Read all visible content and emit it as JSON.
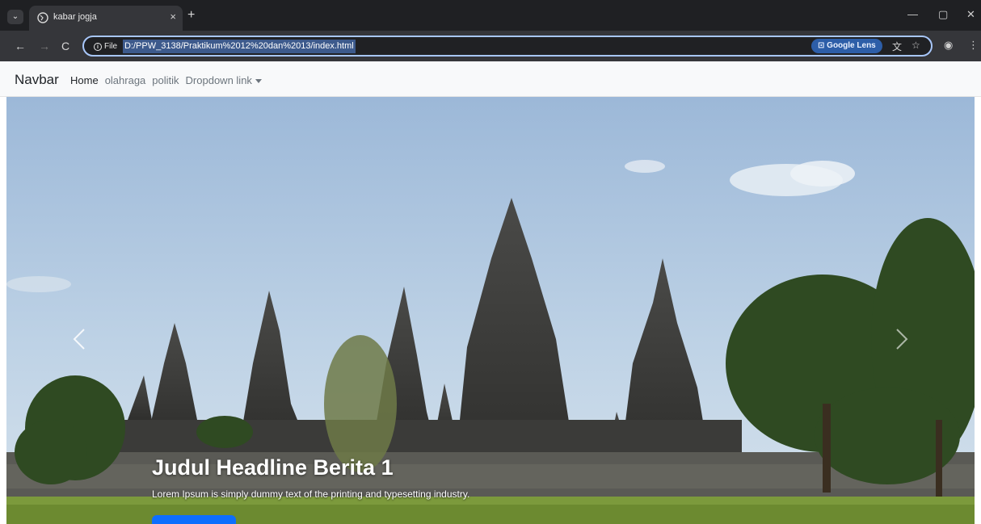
{
  "browser": {
    "tab": {
      "title": "kabar jogja",
      "close": "×"
    },
    "new_tab": "+",
    "window_controls": {
      "minimize": "—",
      "restore": "▢",
      "close": "✕"
    },
    "nav": {
      "back": "←",
      "forward": "→",
      "reload": "C"
    },
    "site_info_label": "File",
    "url": "D:/PPW_3138/Praktikum%2012%20dan%2013/index.html",
    "lens_label": "Google Lens",
    "icons": {
      "translate": "translate-icon",
      "bookmark": "star-icon",
      "profile": "profile-icon",
      "menu": "kebab-menu-icon"
    }
  },
  "navbar": {
    "brand": "Navbar",
    "links": [
      {
        "label": "Home",
        "active": true
      },
      {
        "label": "olahraga",
        "active": false
      },
      {
        "label": "politik",
        "active": false
      },
      {
        "label": "Dropdown link",
        "active": false,
        "dropdown": true
      }
    ]
  },
  "carousel": {
    "caption_title": "Judul Headline Berita 1",
    "caption_text": "Lorem Ipsum is simply dummy text of the printing and typesetting industry.",
    "controls": {
      "prev": "chevron-left-icon",
      "next": "chevron-right-icon"
    }
  },
  "colors": {
    "accent": "#0d6efd",
    "omnibox_focus": "#a8c7fa",
    "chrome_dark": "#1f2023",
    "chrome_toolbar": "#35363a"
  }
}
